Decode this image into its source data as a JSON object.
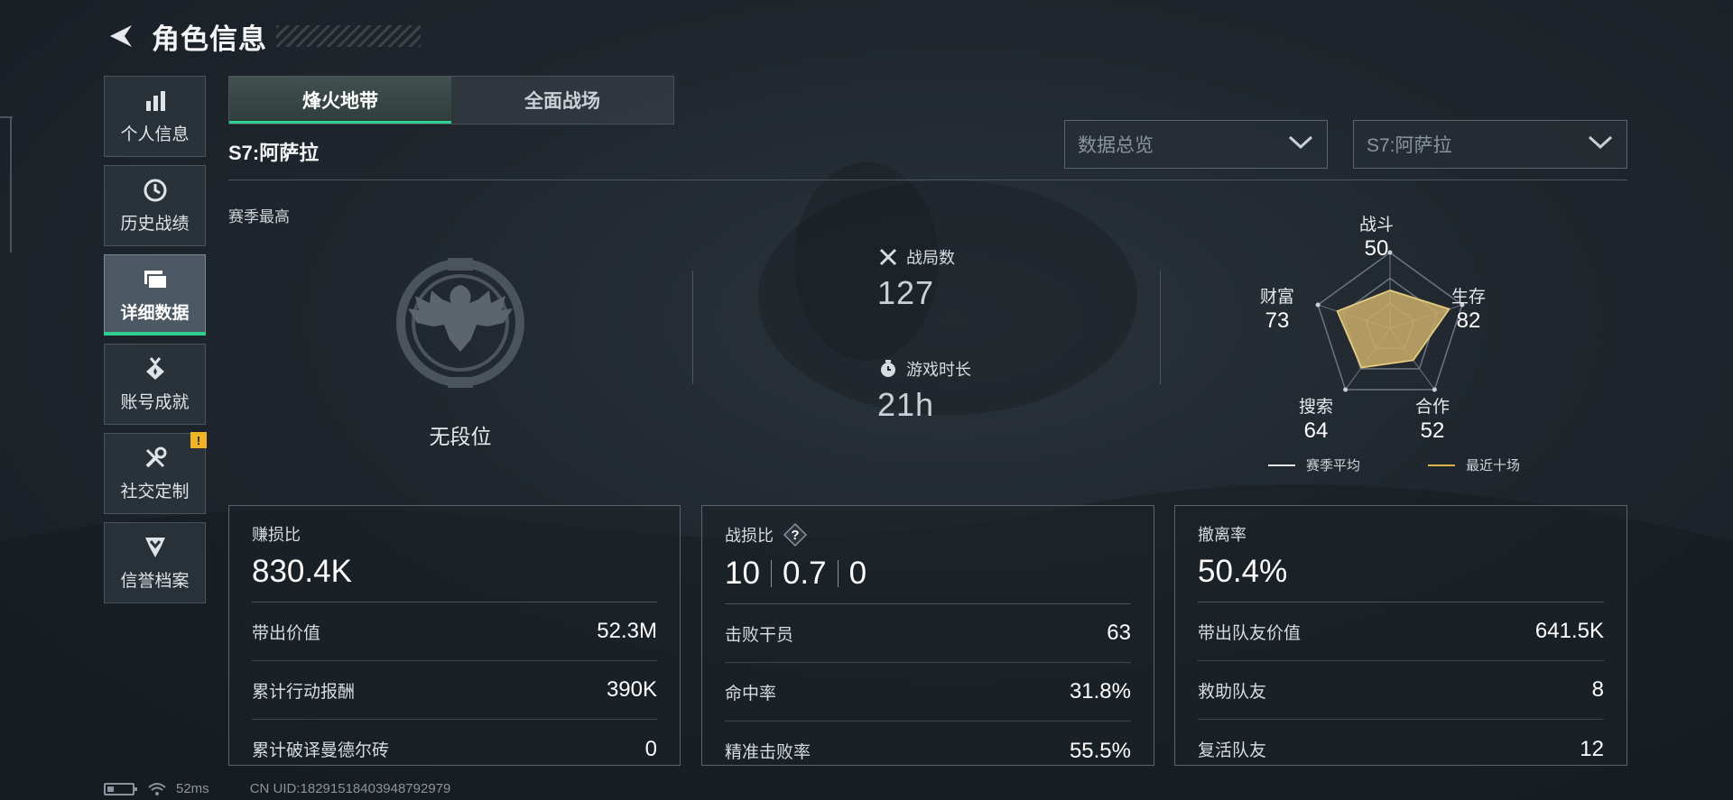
{
  "header": {
    "title": "角色信息"
  },
  "sidebar": {
    "items": [
      {
        "label": "个人信息",
        "icon": "bar-chart-icon",
        "active": false
      },
      {
        "label": "历史战绩",
        "icon": "history-clock-icon",
        "active": false
      },
      {
        "label": "详细数据",
        "icon": "folder-icon",
        "active": true
      },
      {
        "label": "账号成就",
        "icon": "medal-icon",
        "active": false
      },
      {
        "label": "社交定制",
        "icon": "wrench-icon",
        "active": false,
        "badge": "!"
      },
      {
        "label": "信誉档案",
        "icon": "shield-chevron-icon",
        "active": false
      }
    ]
  },
  "tabs": [
    {
      "label": "烽火地带",
      "active": true
    },
    {
      "label": "全面战场",
      "active": false
    }
  ],
  "season": {
    "title": "S7:阿萨拉",
    "best_label": "赛季最高",
    "rank_text": "无段位"
  },
  "filters": {
    "category": "数据总览",
    "season": "S7:阿萨拉"
  },
  "overview": {
    "matches_label": "战局数",
    "matches_value": "127",
    "playtime_label": "游戏时长",
    "playtime_value": "21h"
  },
  "radar": {
    "axes": [
      {
        "label": "战斗",
        "value": "50"
      },
      {
        "label": "生存",
        "value": "82"
      },
      {
        "label": "合作",
        "value": "52"
      },
      {
        "label": "搜索",
        "value": "64"
      },
      {
        "label": "财富",
        "value": "73"
      }
    ],
    "legend": [
      {
        "label": "赛季平均",
        "color": "#e6eaed"
      },
      {
        "label": "最近十场",
        "color": "#d9b44a"
      }
    ]
  },
  "cards": {
    "profit": {
      "title": "赚损比",
      "big": "830.4K",
      "rows": [
        {
          "label": "带出价值",
          "value": "52.3M"
        },
        {
          "label": "累计行动报酬",
          "value": "390K"
        },
        {
          "label": "累计破译曼德尔砖",
          "value": "0"
        }
      ]
    },
    "combat": {
      "title": "战损比",
      "kd": [
        "10",
        "0.7",
        "0"
      ],
      "rows": [
        {
          "label": "击败干员",
          "value": "63"
        },
        {
          "label": "命中率",
          "value": "31.8%"
        },
        {
          "label": "精准击败率",
          "value": "55.5%"
        }
      ]
    },
    "extract": {
      "title": "撤离率",
      "big": "50.4%",
      "rows": [
        {
          "label": "带出队友价值",
          "value": "641.5K"
        },
        {
          "label": "救助队友",
          "value": "8"
        },
        {
          "label": "复活队友",
          "value": "12"
        }
      ]
    }
  },
  "footer": {
    "ping": "52ms",
    "uid": "CN UID:18291518403948792979"
  },
  "colors": {
    "accent": "#2fcf92",
    "badge": "#f0b323",
    "radar_fill": "#c9ae6a"
  }
}
